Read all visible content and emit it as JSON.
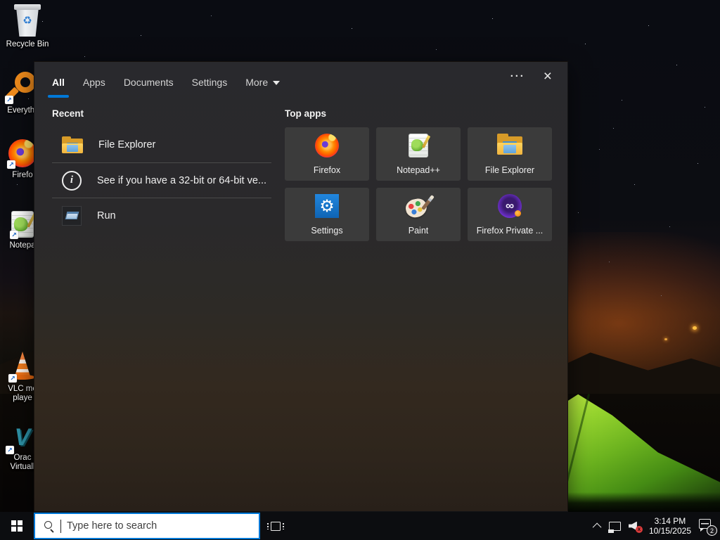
{
  "desktop": {
    "icons": [
      {
        "name": "recycle-bin",
        "label": "Recycle Bin"
      },
      {
        "name": "everything",
        "label": "Everythi"
      },
      {
        "name": "firefox",
        "label": "Firefo"
      },
      {
        "name": "notepad-plus-plus",
        "label": "Notepa"
      },
      {
        "name": "vlc-media-player",
        "label": "VLC me\nplaye"
      },
      {
        "name": "oracle-virtualbox",
        "label": "Orac\nVirtuall"
      }
    ]
  },
  "search_panel": {
    "tabs": [
      {
        "label": "All",
        "active": true
      },
      {
        "label": "Apps",
        "active": false
      },
      {
        "label": "Documents",
        "active": false
      },
      {
        "label": "Settings",
        "active": false
      },
      {
        "label": "More",
        "active": false,
        "has_dropdown": true
      }
    ],
    "icons": {
      "ellipsis": "···",
      "close": "×",
      "info_glyph": "i",
      "recycle_glyph": "♻",
      "shortcut_arrow": "↗",
      "gear_glyph": "⚙",
      "infinity_glyph": "∞",
      "vbox_glyph": "V",
      "mute_glyph": "x"
    },
    "recent": {
      "heading": "Recent",
      "items": [
        {
          "label": "File Explorer",
          "icon": "folder-icon"
        },
        {
          "label": "See if you have a 32-bit or 64-bit ve...",
          "icon": "info-icon"
        },
        {
          "label": "Run",
          "icon": "run-window-icon"
        }
      ]
    },
    "top_apps": {
      "heading": "Top apps",
      "tiles": [
        {
          "label": "Firefox",
          "icon": "firefox-icon"
        },
        {
          "label": "Notepad++",
          "icon": "notepad-plus-plus-icon"
        },
        {
          "label": "File Explorer",
          "icon": "folder-icon"
        },
        {
          "label": "Settings",
          "icon": "settings-gear-icon"
        },
        {
          "label": "Paint",
          "icon": "paint-palette-icon"
        },
        {
          "label": "Firefox Private ...",
          "icon": "firefox-private-icon"
        }
      ]
    }
  },
  "taskbar": {
    "search_placeholder": "Type here to search",
    "tray": {
      "time": "3:14 PM",
      "date": "10/15/2025",
      "notification_count": "2"
    }
  },
  "colors": {
    "accent": "#0078d7",
    "panel": "#2a2a2c",
    "tile": "#3b3b3b",
    "taskbar": "#0c0d10",
    "mute_red": "#d83b3b",
    "tent_green": "#86c727"
  }
}
